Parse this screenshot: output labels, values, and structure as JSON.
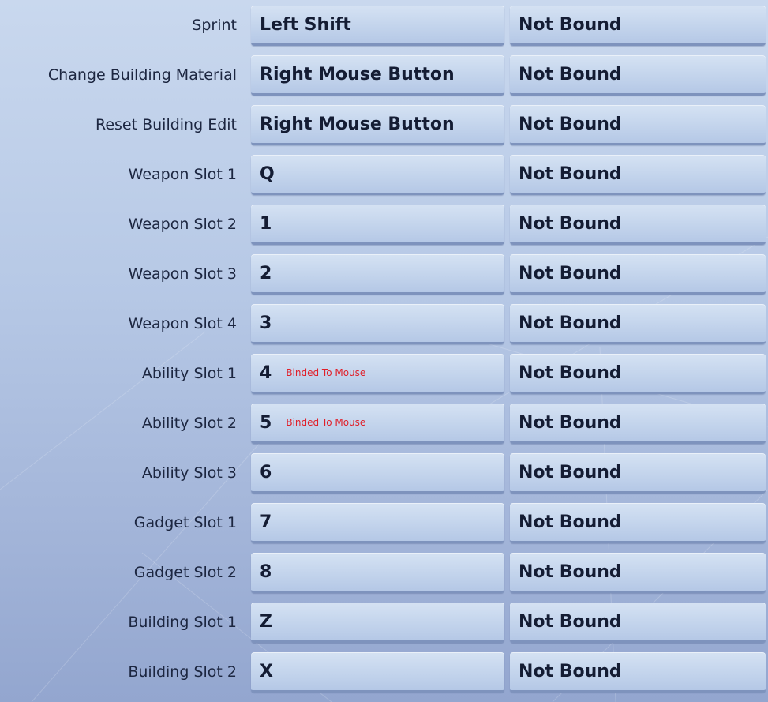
{
  "colors": {
    "note_text": "#e0202a",
    "key_text": "#141c33",
    "label_text": "#1c2640"
  },
  "bindings": [
    {
      "action": "Sprint",
      "primary": "Left Shift",
      "secondary": "Not Bound",
      "note": ""
    },
    {
      "action": "Change Building Material",
      "primary": "Right Mouse Button",
      "secondary": "Not Bound",
      "note": ""
    },
    {
      "action": "Reset Building Edit",
      "primary": "Right Mouse Button",
      "secondary": "Not Bound",
      "note": ""
    },
    {
      "action": "Weapon Slot 1",
      "primary": "Q",
      "secondary": "Not Bound",
      "note": ""
    },
    {
      "action": "Weapon Slot 2",
      "primary": "1",
      "secondary": "Not Bound",
      "note": ""
    },
    {
      "action": "Weapon Slot 3",
      "primary": "2",
      "secondary": "Not Bound",
      "note": ""
    },
    {
      "action": "Weapon Slot 4",
      "primary": "3",
      "secondary": "Not Bound",
      "note": ""
    },
    {
      "action": "Ability Slot 1",
      "primary": "4",
      "secondary": "Not Bound",
      "note": "Binded To Mouse"
    },
    {
      "action": "Ability Slot 2",
      "primary": "5",
      "secondary": "Not Bound",
      "note": "Binded To Mouse"
    },
    {
      "action": "Ability Slot 3",
      "primary": "6",
      "secondary": "Not Bound",
      "note": ""
    },
    {
      "action": "Gadget Slot 1",
      "primary": "7",
      "secondary": "Not Bound",
      "note": ""
    },
    {
      "action": "Gadget Slot 2",
      "primary": "8",
      "secondary": "Not Bound",
      "note": ""
    },
    {
      "action": "Building Slot 1",
      "primary": "Z",
      "secondary": "Not Bound",
      "note": ""
    },
    {
      "action": "Building Slot 2",
      "primary": "X",
      "secondary": "Not Bound",
      "note": ""
    }
  ]
}
